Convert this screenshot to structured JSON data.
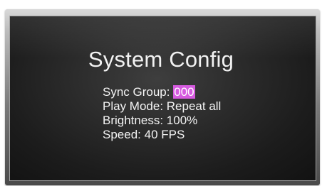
{
  "screen": {
    "title": "System Config",
    "items": [
      {
        "label": "Sync Group:",
        "value": "000",
        "selected": true
      },
      {
        "label": "Play Mode:",
        "value": "Repeat all",
        "selected": false
      },
      {
        "label": "Brightness:",
        "value": "100%",
        "selected": false
      },
      {
        "label": "Speed:",
        "value": "40 FPS",
        "selected": false
      }
    ]
  },
  "colors": {
    "selection_highlight": "#d65ae0",
    "text": "#f4f4f4",
    "screen_background": "#1c1c1c"
  }
}
